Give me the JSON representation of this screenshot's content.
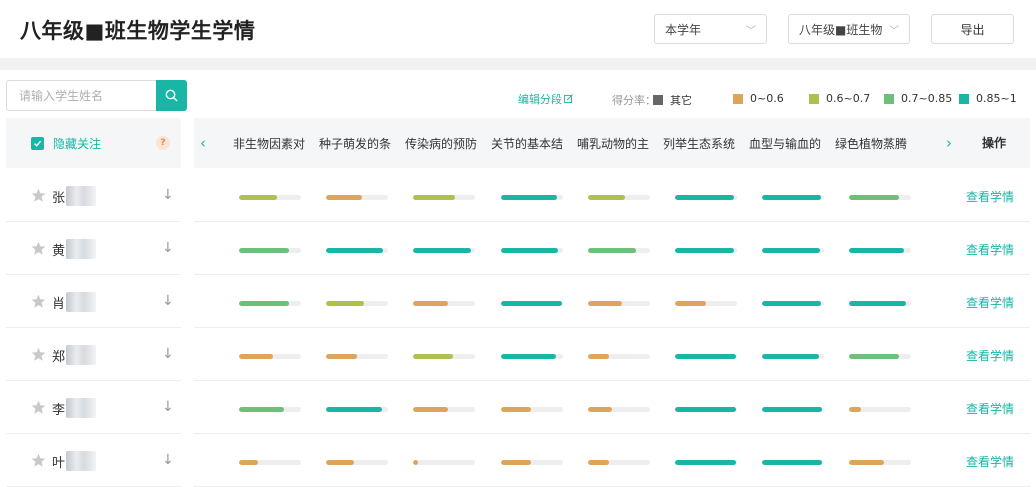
{
  "header": {
    "title": "八年级■班生物学生学情",
    "year_select": "本学年",
    "class_select": "八年级■班生物",
    "export_label": "导出"
  },
  "search": {
    "placeholder": "请输入学生姓名",
    "icon": "search-icon"
  },
  "legend": {
    "edit_label": "编辑分段",
    "score_label": "得分率：",
    "items": [
      {
        "label": "其它",
        "color": "#666666"
      },
      {
        "label": "0~0.6",
        "color": "#dba55b"
      },
      {
        "label": "0.6~0.7",
        "color": "#aec04f"
      },
      {
        "label": "0.7~0.85",
        "color": "#6dbf7a"
      },
      {
        "label": "0.85~1",
        "color": "#19b5a5"
      }
    ]
  },
  "filter": {
    "hide_followed_label": "隐藏关注",
    "help_icon": "?"
  },
  "columns": [
    "非生物因素对",
    "种子萌发的条",
    "传染病的预防",
    "关节的基本结",
    "哺乳动物的主",
    "列举生态系统",
    "血型与输血的",
    "绿色植物蒸腾"
  ],
  "operation_header": "操作",
  "action_label": "查看学情",
  "students": [
    {
      "name": "张",
      "scores": [
        0.62,
        0.58,
        0.68,
        0.9,
        0.6,
        0.95,
        0.95,
        0.8
      ]
    },
    {
      "name": "黄",
      "scores": [
        0.8,
        0.92,
        0.93,
        0.92,
        0.78,
        0.95,
        0.93,
        0.88
      ]
    },
    {
      "name": "肖",
      "scores": [
        0.8,
        0.62,
        0.56,
        0.98,
        0.55,
        0.5,
        0.95,
        0.92
      ]
    },
    {
      "name": "郑",
      "scores": [
        0.55,
        0.5,
        0.65,
        0.88,
        0.34,
        0.98,
        0.92,
        0.8
      ]
    },
    {
      "name": "李",
      "scores": [
        0.72,
        0.9,
        0.57,
        0.48,
        0.38,
        0.98,
        0.97,
        0.2
      ]
    },
    {
      "name": "叶",
      "scores": [
        0.3,
        0.45,
        0.08,
        0.48,
        0.34,
        0.98,
        0.97,
        0.56
      ]
    }
  ]
}
